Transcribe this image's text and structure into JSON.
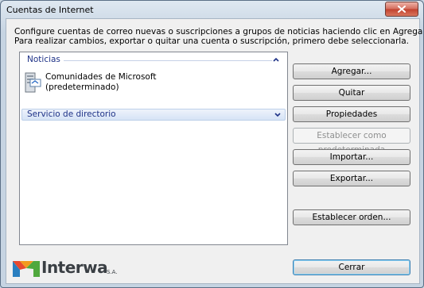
{
  "window": {
    "title": "Cuentas de Internet"
  },
  "description": {
    "line1": "Configure cuentas de correo nuevas o suscripciones a grupos de noticias haciendo clic en Agregar.",
    "line2": "Para realizar cambios, exportar o quitar una cuenta o suscripción, primero debe seleccionarla."
  },
  "list": {
    "groups": [
      {
        "label": "Noticias",
        "expanded": true
      },
      {
        "label": "Servicio de directorio",
        "expanded": false
      }
    ],
    "accounts": [
      {
        "name": "Comunidades de Microsoft",
        "sub": "(predeterminado)",
        "icon": "news-server-icon"
      }
    ]
  },
  "buttons": {
    "add": "Agregar...",
    "remove": "Quitar",
    "properties": "Propiedades",
    "set_default": "Establecer como predeterminada",
    "import": "Importar...",
    "export": "Exportar...",
    "set_order": "Establecer orden...",
    "close": "Cerrar"
  },
  "logo": {
    "text": "Interwa",
    "suffix": "S.A."
  },
  "colors": {
    "group_label": "#1e3287",
    "close_button": "#c1412d"
  }
}
